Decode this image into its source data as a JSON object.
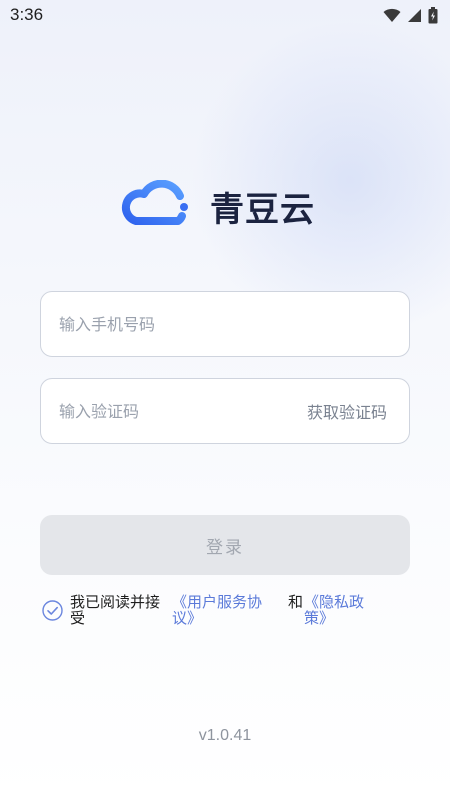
{
  "status_bar": {
    "time": "3:36"
  },
  "brand": {
    "name": "青豆云",
    "primary_color": "#3a6ff2",
    "text_color": "#1b2340"
  },
  "form": {
    "phone_placeholder": "输入手机号码",
    "code_placeholder": "输入验证码",
    "get_code_label": "获取验证码",
    "login_label": "登录"
  },
  "agreement": {
    "checked": true,
    "prefix": "我已阅读并接受",
    "user_agreement": "《用户服务协议》",
    "conjunction": "和",
    "privacy_policy": "《隐私政策》",
    "link_color": "#5b7ad9"
  },
  "footer": {
    "version": "v1.0.41"
  }
}
